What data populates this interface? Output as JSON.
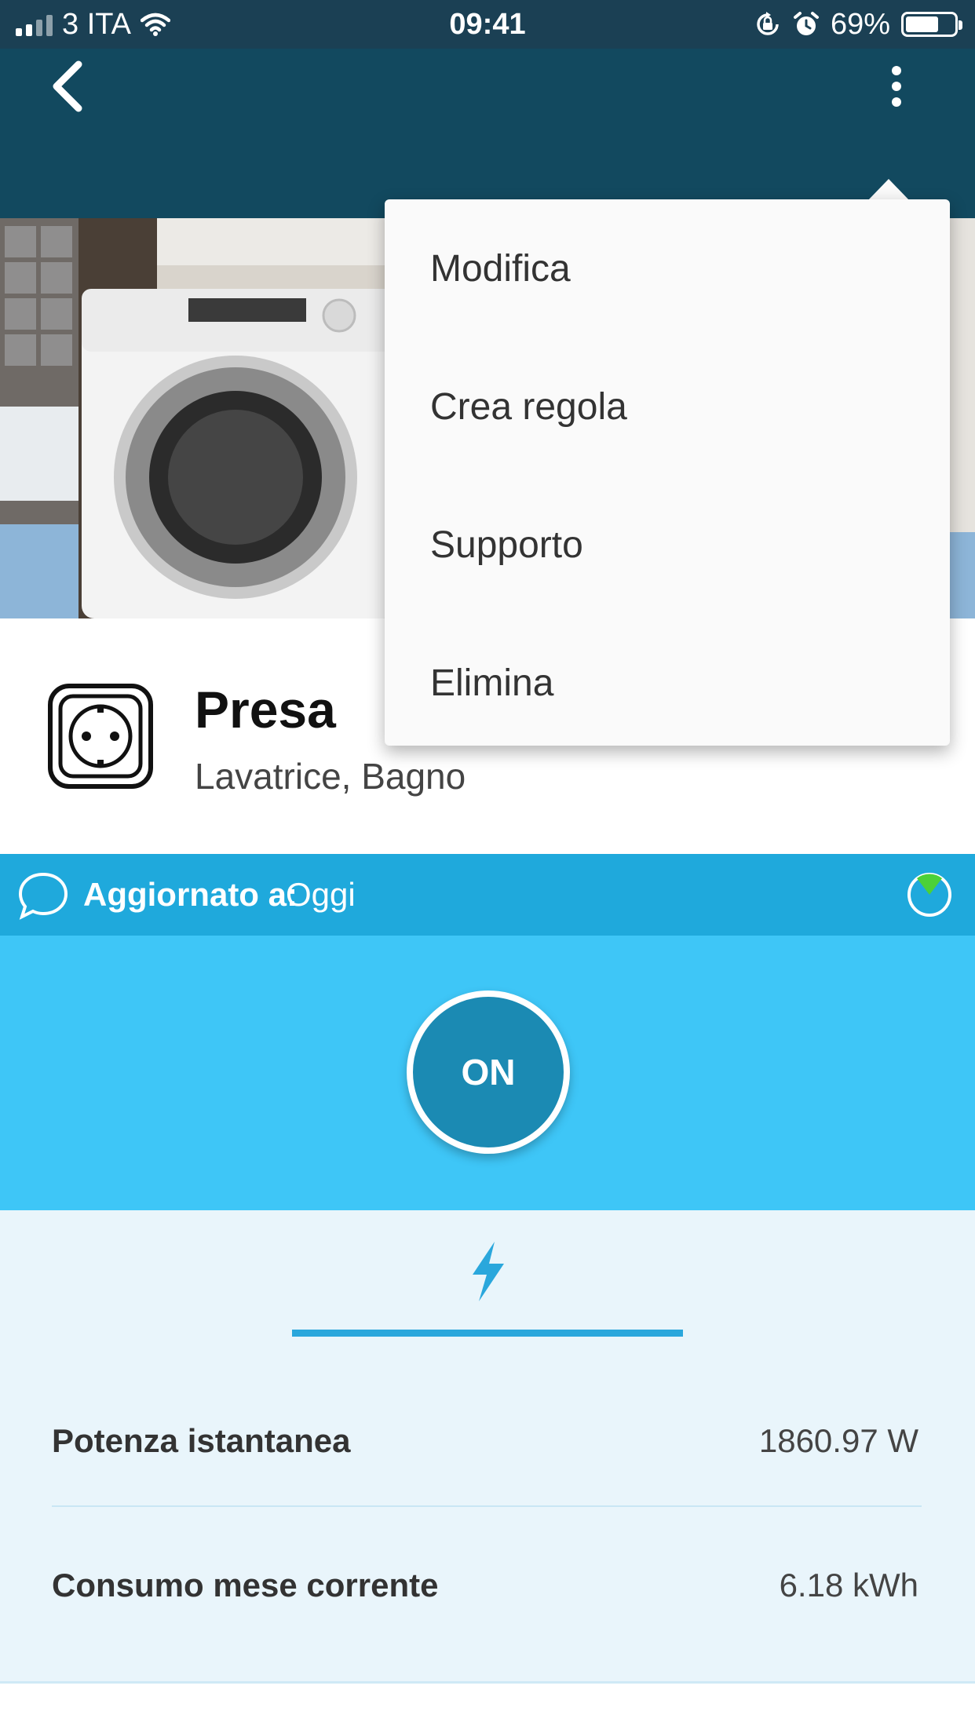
{
  "status_bar": {
    "carrier": "3 ITA",
    "time": "09:41",
    "battery_percent": "69%",
    "battery_level": 0.69,
    "icons": [
      "signal-icon",
      "wifi-icon",
      "orientation-lock-icon",
      "alarm-icon",
      "battery-icon"
    ]
  },
  "nav": {
    "back_icon": "chevron-left-icon",
    "more_icon": "more-vertical-icon"
  },
  "menu": {
    "items": [
      {
        "label": "Modifica"
      },
      {
        "label": "Crea regola"
      },
      {
        "label": "Supporto"
      },
      {
        "label": "Elimina"
      }
    ]
  },
  "device": {
    "icon": "power-socket-icon",
    "title": "Presa",
    "subtitle": "Lavatrice, Bagno"
  },
  "update": {
    "label": "Aggiornato a:",
    "value": "Oggi",
    "icon": "chat-bubble-icon",
    "status_icon": "timer-icon"
  },
  "switch": {
    "label": "ON"
  },
  "tabs": {
    "active_icon": "lightning-bolt-icon"
  },
  "metrics": [
    {
      "label": "Potenza istantanea",
      "value": "1860.97 W"
    },
    {
      "label": "Consumo mese corrente",
      "value": "6.18 kWh"
    }
  ],
  "colors": {
    "status_bar": "#1b4054",
    "nav_bar": "#12495f",
    "update_bar": "#1fa9dc",
    "switch_panel": "#3ec6f7",
    "on_button": "#1b8ab3",
    "metrics_bg": "#e9f5fb",
    "accent": "#2aa7dc"
  }
}
